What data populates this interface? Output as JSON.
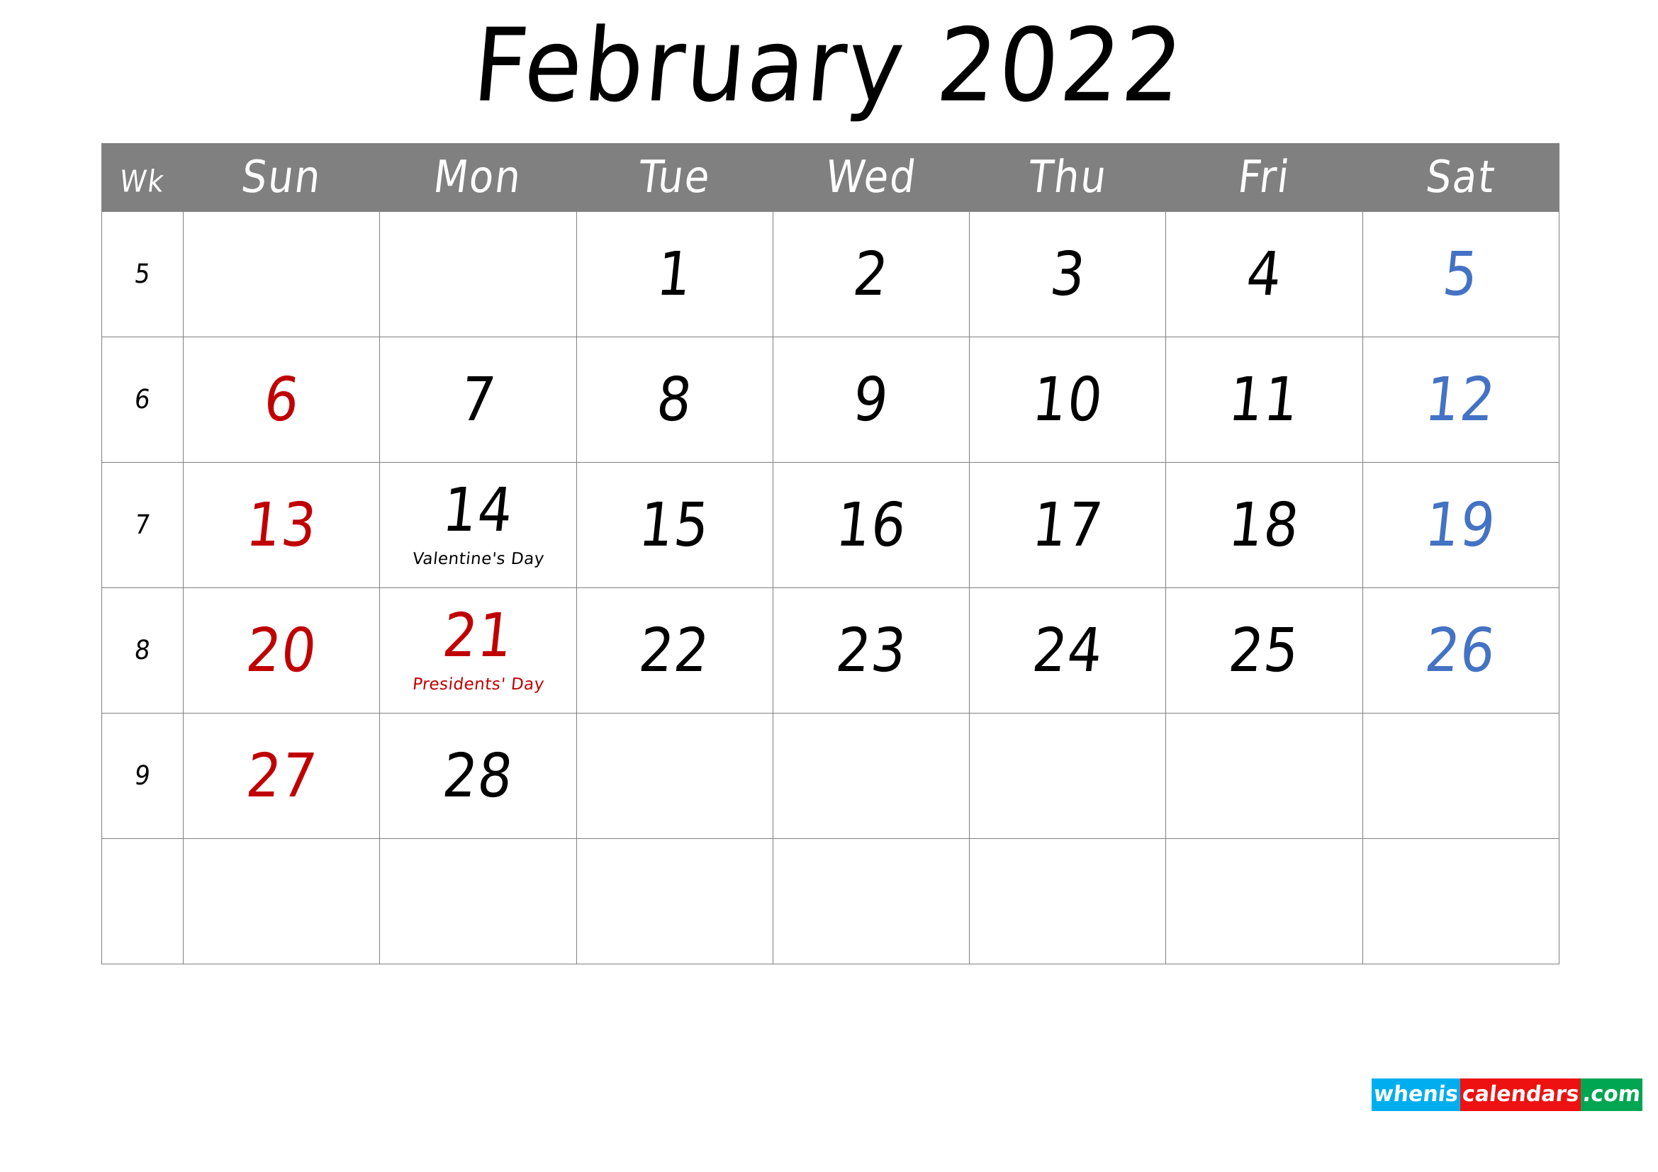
{
  "title": "February 2022",
  "colors": {
    "header_bg": "#808080",
    "header_text": "#ffffff",
    "grid_line": "#808080",
    "sunday": "#C00000",
    "saturday": "#4472C4",
    "weekday": "#000000",
    "holiday_red": "#C00000",
    "logo_blue": "#00AEEF",
    "logo_red": "#EE1111",
    "logo_green": "#00A651"
  },
  "headers": [
    {
      "key": "wk",
      "label": "Wk"
    },
    {
      "key": "sun",
      "label": "Sun"
    },
    {
      "key": "mon",
      "label": "Mon"
    },
    {
      "key": "tue",
      "label": "Tue"
    },
    {
      "key": "wed",
      "label": "Wed"
    },
    {
      "key": "thu",
      "label": "Thu"
    },
    {
      "key": "fri",
      "label": "Fri"
    },
    {
      "key": "sat",
      "label": "Sat"
    }
  ],
  "weeks": [
    {
      "wk": "5",
      "days": [
        {
          "num": "",
          "style": "sun",
          "holiday": ""
        },
        {
          "num": "",
          "style": "weekday",
          "holiday": ""
        },
        {
          "num": "1",
          "style": "weekday",
          "holiday": ""
        },
        {
          "num": "2",
          "style": "weekday",
          "holiday": ""
        },
        {
          "num": "3",
          "style": "weekday",
          "holiday": ""
        },
        {
          "num": "4",
          "style": "weekday",
          "holiday": ""
        },
        {
          "num": "5",
          "style": "sat",
          "holiday": ""
        }
      ]
    },
    {
      "wk": "6",
      "days": [
        {
          "num": "6",
          "style": "sun",
          "holiday": ""
        },
        {
          "num": "7",
          "style": "weekday",
          "holiday": ""
        },
        {
          "num": "8",
          "style": "weekday",
          "holiday": ""
        },
        {
          "num": "9",
          "style": "weekday",
          "holiday": ""
        },
        {
          "num": "10",
          "style": "weekday",
          "holiday": ""
        },
        {
          "num": "11",
          "style": "weekday",
          "holiday": ""
        },
        {
          "num": "12",
          "style": "sat",
          "holiday": ""
        }
      ]
    },
    {
      "wk": "7",
      "days": [
        {
          "num": "13",
          "style": "sun",
          "holiday": ""
        },
        {
          "num": "14",
          "style": "weekday",
          "holiday": "Valentine's Day",
          "holiday_color": "black"
        },
        {
          "num": "15",
          "style": "weekday",
          "holiday": ""
        },
        {
          "num": "16",
          "style": "weekday",
          "holiday": ""
        },
        {
          "num": "17",
          "style": "weekday",
          "holiday": ""
        },
        {
          "num": "18",
          "style": "weekday",
          "holiday": ""
        },
        {
          "num": "19",
          "style": "sat",
          "holiday": ""
        }
      ]
    },
    {
      "wk": "8",
      "days": [
        {
          "num": "20",
          "style": "sun",
          "holiday": ""
        },
        {
          "num": "21",
          "style": "holiday",
          "holiday": "Presidents' Day",
          "holiday_color": "red"
        },
        {
          "num": "22",
          "style": "weekday",
          "holiday": ""
        },
        {
          "num": "23",
          "style": "weekday",
          "holiday": ""
        },
        {
          "num": "24",
          "style": "weekday",
          "holiday": ""
        },
        {
          "num": "25",
          "style": "weekday",
          "holiday": ""
        },
        {
          "num": "26",
          "style": "sat",
          "holiday": ""
        }
      ]
    },
    {
      "wk": "9",
      "days": [
        {
          "num": "27",
          "style": "sun",
          "holiday": ""
        },
        {
          "num": "28",
          "style": "weekday",
          "holiday": ""
        },
        {
          "num": "",
          "style": "weekday",
          "holiday": ""
        },
        {
          "num": "",
          "style": "weekday",
          "holiday": ""
        },
        {
          "num": "",
          "style": "weekday",
          "holiday": ""
        },
        {
          "num": "",
          "style": "weekday",
          "holiday": ""
        },
        {
          "num": "",
          "style": "sat",
          "holiday": ""
        }
      ]
    },
    {
      "wk": "",
      "days": [
        {
          "num": "",
          "style": "sun",
          "holiday": ""
        },
        {
          "num": "",
          "style": "weekday",
          "holiday": ""
        },
        {
          "num": "",
          "style": "weekday",
          "holiday": ""
        },
        {
          "num": "",
          "style": "weekday",
          "holiday": ""
        },
        {
          "num": "",
          "style": "weekday",
          "holiday": ""
        },
        {
          "num": "",
          "style": "weekday",
          "holiday": ""
        },
        {
          "num": "",
          "style": "sat",
          "holiday": ""
        }
      ]
    }
  ],
  "logo": {
    "part1": "whenis",
    "part2": "calendars",
    "part3": ".com"
  }
}
